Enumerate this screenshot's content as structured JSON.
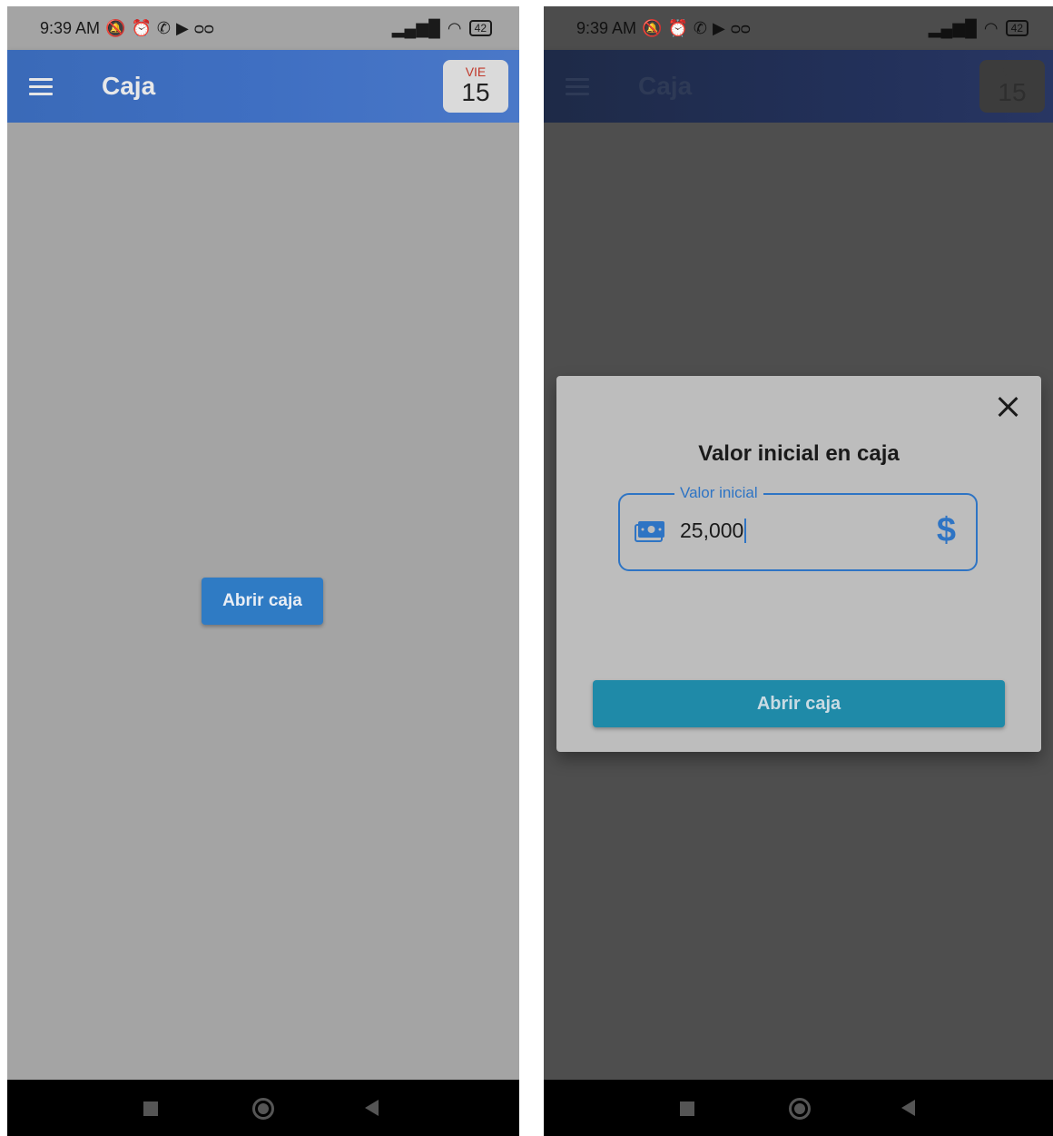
{
  "left_screen": {
    "status_bar": {
      "time": "9:39 AM",
      "battery": "42"
    },
    "app_bar": {
      "title": "Caja",
      "date_dow": "VIE",
      "date_day": "15"
    },
    "open_button_label": "Abrir caja"
  },
  "right_screen": {
    "status_bar": {
      "time": "9:39 AM",
      "battery": "42"
    },
    "app_bar": {
      "title": "Caja",
      "date_dow": "VIE",
      "date_day": "15"
    },
    "dialog": {
      "title": "Valor inicial en caja",
      "field_label": "Valor inicial",
      "field_value": "25,000",
      "currency_symbol": "$",
      "submit_label": "Abrir caja"
    }
  },
  "colors": {
    "accent": "#2e74c4",
    "appbar": "#3f6fc2",
    "dialog_button": "#1f8aa8"
  },
  "icons": [
    "menu-icon",
    "muted-bell-icon",
    "alarm-icon",
    "whatsapp-icon",
    "youtube-icon",
    "voicemail-icon",
    "signal-icon",
    "wifi-icon",
    "battery-icon",
    "close-icon",
    "cash-icon",
    "dollar-icon",
    "nav-recent-icon",
    "nav-home-icon",
    "nav-back-icon"
  ]
}
